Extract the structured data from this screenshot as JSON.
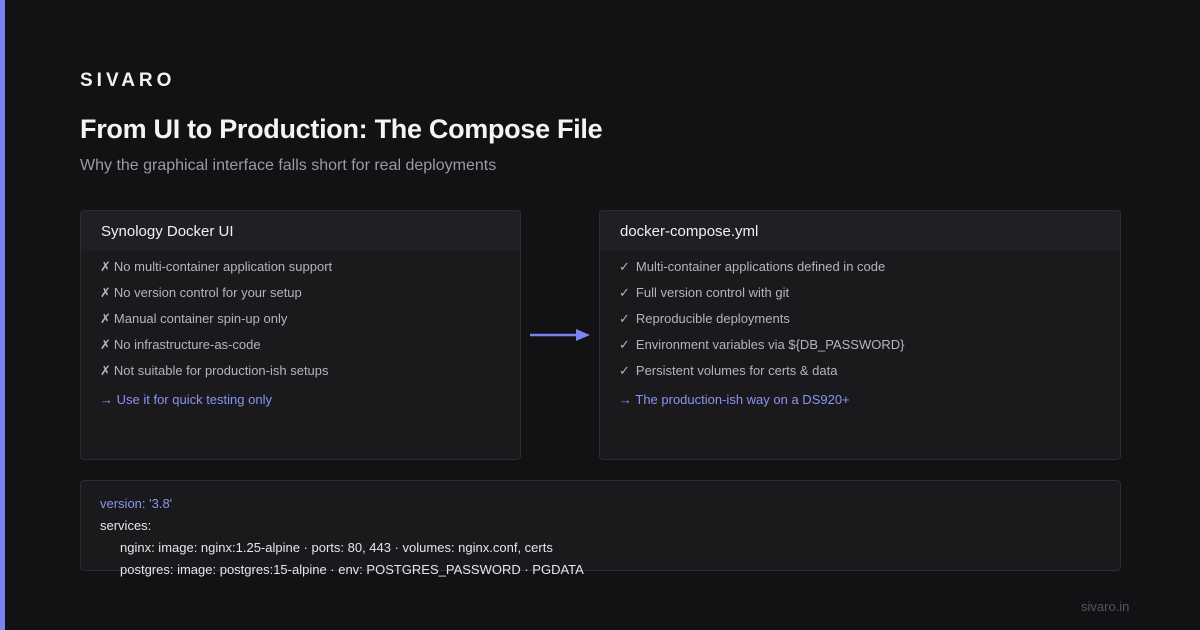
{
  "brand": "SIVARO",
  "title": "From UI to Production: The Compose File",
  "subtitle": "Why the graphical interface falls short for real deployments",
  "left_card": {
    "header": "Synology Docker UI",
    "mark": "✗",
    "items": [
      "No multi-container application support",
      "No version control for your setup",
      "Manual container spin-up only",
      "No infrastructure-as-code",
      "Not suitable for production-ish setups"
    ],
    "footer": "→ Use it for quick testing only"
  },
  "right_card": {
    "header": "docker-compose.yml",
    "mark": "✓",
    "items": [
      "Multi-container applications defined in code",
      "Full version control with git",
      "Reproducible deployments",
      "Environment variables via ${DB_PASSWORD}",
      "Persistent volumes for certs & data"
    ],
    "footer": "→ The production-ish way on a DS920+"
  },
  "arrow_icon": "arrow-right-icon",
  "code": {
    "version_line": "version: '3.8'",
    "services_line": "services:",
    "nginx_line": "nginx: image: nginx:1.25-alpine · ports: 80, 443 · volumes: nginx.conf, certs",
    "postgres_line": "postgres: image: postgres:15-alpine · env: POSTGRES_PASSWORD · PGDATA"
  },
  "footer_url": "sivaro.in",
  "colors": {
    "background": "#121214",
    "accent": "#7c83f0",
    "card_bg": "#1a1a1d",
    "card_header_bg": "#202024",
    "link": "#8b92f4"
  }
}
